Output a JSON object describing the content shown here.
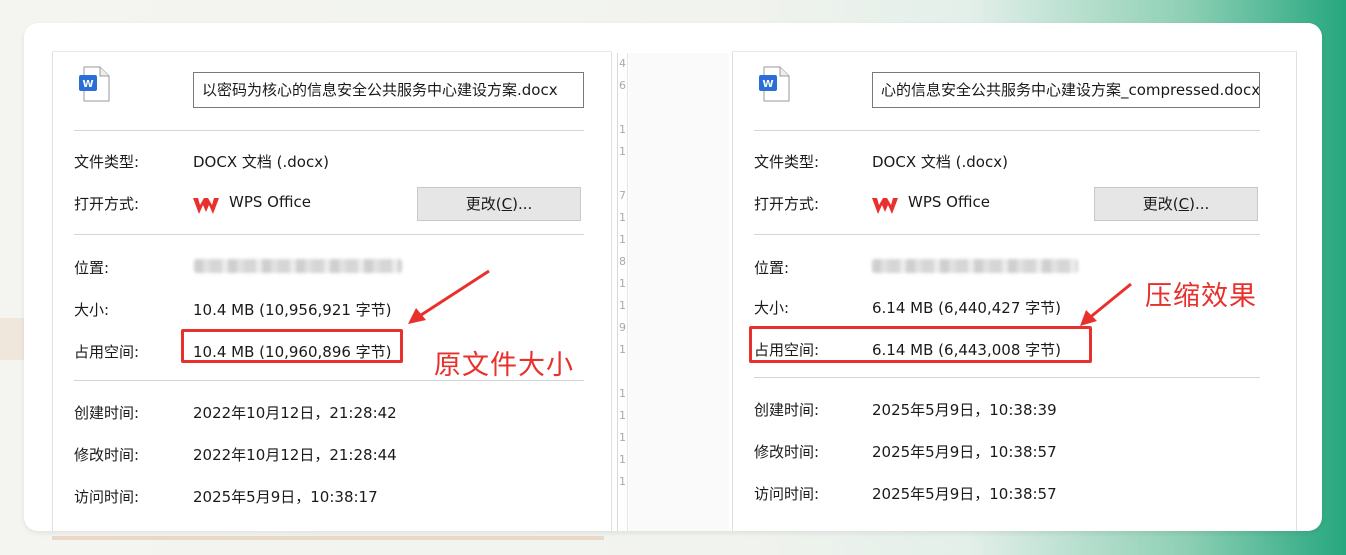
{
  "left": {
    "filename": "以密码为核心的信息安全公共服务中心建设方案.docx",
    "type_label": "文件类型:",
    "type_value": "DOCX 文档 (.docx)",
    "open_label": "打开方式:",
    "open_value": "WPS Office",
    "change_label": "更改(",
    "change_key": "C",
    "change_suffix": ")...",
    "location_label": "位置:",
    "size_label": "大小:",
    "size_value": "10.4 MB (10,956,921 字节)",
    "disk_label": "占用空间:",
    "disk_value": "10.4 MB (10,960,896 字节)",
    "created_label": "创建时间:",
    "created_value": "2022年10月12日，21:28:42",
    "modified_label": "修改时间:",
    "modified_value": "2022年10月12日，21:28:44",
    "accessed_label": "访问时间:",
    "accessed_value": "2025年5月9日，10:38:17",
    "annotation": "原文件大小"
  },
  "right": {
    "filename": "心的信息安全公共服务中心建设方案_compressed.docx",
    "type_label": "文件类型:",
    "type_value": "DOCX 文档 (.docx)",
    "open_label": "打开方式:",
    "open_value": "WPS Office",
    "change_label": "更改(",
    "change_key": "C",
    "change_suffix": ")...",
    "location_label": "位置:",
    "size_label": "大小:",
    "size_value": "6.14 MB (6,440,427 字节)",
    "disk_label": "占用空间:",
    "disk_value": "6.14 MB (6,443,008 字节)",
    "created_label": "创建时间:",
    "created_value": "2025年5月9日，10:38:39",
    "modified_label": "修改时间:",
    "modified_value": "2025年5月9日，10:38:57",
    "accessed_label": "访问时间:",
    "accessed_value": "2025年5月9日，10:38:57",
    "annotation": "压缩效果"
  },
  "edge_glyphs": [
    "4",
    "6",
    "",
    "1",
    "1",
    "",
    "7",
    "1",
    "1",
    "8",
    "1",
    "1",
    "9",
    "1",
    "",
    "1",
    "1",
    "1",
    "1",
    "1"
  ],
  "colors": {
    "highlight": "#e8302c",
    "word_icon": "#2b6fd6",
    "wps_logo": "#e8302c"
  },
  "icons": {
    "file": "word-document-icon",
    "app": "wps-office-logo"
  }
}
